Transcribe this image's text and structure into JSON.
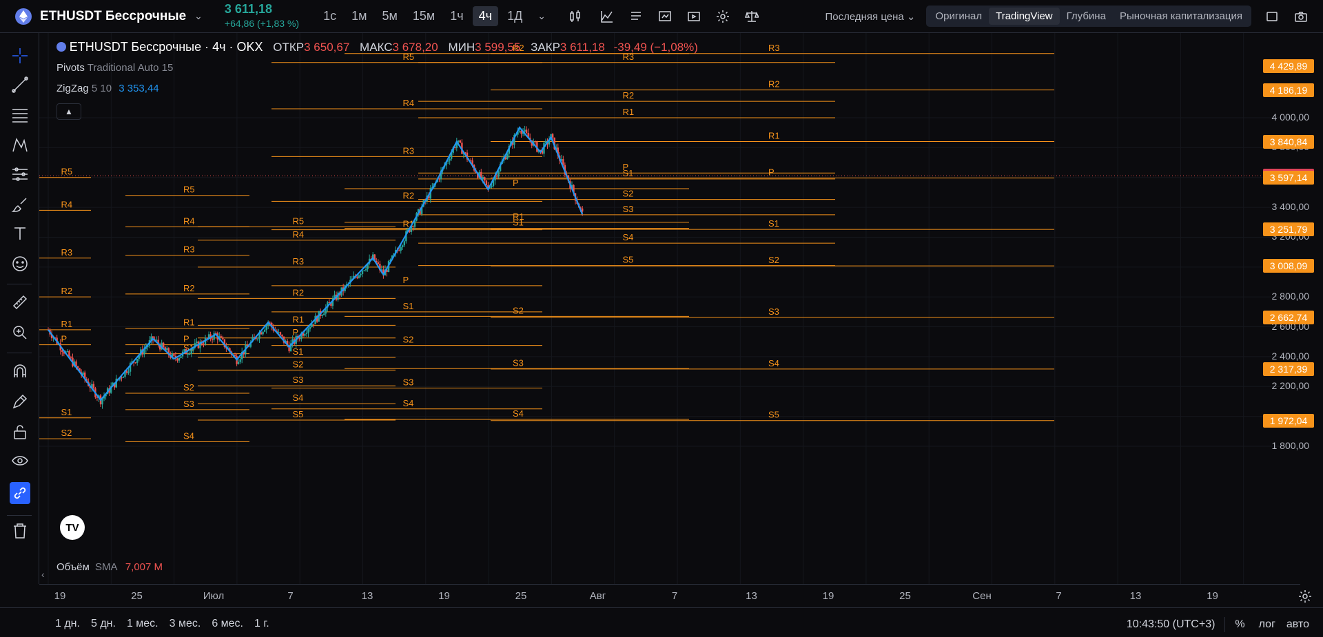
{
  "header": {
    "symbol": "ETHUSDT Бессрочные",
    "price": "3 611,18",
    "change": "+64,86 (+1,83 %)",
    "timeframes": [
      "1с",
      "1м",
      "5м",
      "15м",
      "1ч",
      "4ч",
      "1Д"
    ],
    "active_timeframe": "4ч",
    "price_type": "Последняя цена",
    "views": [
      "Оригинал",
      "TradingView",
      "Глубина",
      "Рыночная капитализация"
    ],
    "active_view": "TradingView"
  },
  "legend": {
    "title": "ETHUSDT Бессрочные · 4ч · OKX",
    "open_label": "ОТКР",
    "open": "3 650,67",
    "high_label": "МАКС",
    "high": "3 678,20",
    "low_label": "МИН",
    "low": "3 599,55",
    "close_label": "ЗАКР",
    "close": "3 611,18",
    "change": "-39,49 (−1,08%)"
  },
  "indicators": {
    "pivots_name": "Pivots",
    "pivots_params": "Traditional Auto 15",
    "zigzag_name": "ZigZag",
    "zigzag_params": "5 10",
    "zigzag_value": "3 353,44"
  },
  "volume": {
    "name": "Объём",
    "ma": "SMA",
    "value": "7,007 M"
  },
  "price_axis": {
    "labels": [
      "4 000,00",
      "3 800,00",
      "3 400,00",
      "3 200,00",
      "2 800,00",
      "2 600,00",
      "2 400,00",
      "2 200,00",
      "1 800,00"
    ],
    "boxes": [
      {
        "text": "4 429,89",
        "color": "#f7931a"
      },
      {
        "text": "4 186,19",
        "color": "#f7931a"
      },
      {
        "text": "3 840,84",
        "color": "#f7931a"
      },
      {
        "text": "3 611,18",
        "color": "#e0435a"
      },
      {
        "text": "3 597,14",
        "color": "#f7931a"
      },
      {
        "text": "3 251,79",
        "color": "#f7931a"
      },
      {
        "text": "3 008,09",
        "color": "#f7931a"
      },
      {
        "text": "2 662,74",
        "color": "#f7931a"
      },
      {
        "text": "2 317,39",
        "color": "#f7931a"
      },
      {
        "text": "1 972,04",
        "color": "#f7931a"
      }
    ]
  },
  "time_axis": [
    "19",
    "25",
    "Июл",
    "7",
    "13",
    "19",
    "25",
    "Авг",
    "7",
    "13",
    "19",
    "25",
    "Сен",
    "7",
    "13",
    "19"
  ],
  "bottom": {
    "ranges": [
      "1 дн.",
      "5 дн.",
      "1 мес.",
      "3 мес.",
      "6 мес.",
      "1 г."
    ],
    "clock": "10:43:50 (UTC+3)",
    "percent": "%",
    "log": "лог",
    "auto": "авто"
  },
  "colors": {
    "up": "#26a69a",
    "down": "#ef5350",
    "pivot": "#f7931a",
    "zigzag": "#2196f3",
    "accent": "#2962ff"
  },
  "chart_data": {
    "type": "candlestick",
    "symbol": "ETHUSDT",
    "ylim": [
      1800,
      4600
    ],
    "zigzag": [
      {
        "x": "Jun 19",
        "y": 2580
      },
      {
        "x": "Jun 24",
        "y": 2110
      },
      {
        "x": "Jun 29",
        "y": 2520
      },
      {
        "x": "Jul 1",
        "y": 2385
      },
      {
        "x": "Jul 5",
        "y": 2550
      },
      {
        "x": "Jul 7",
        "y": 2380
      },
      {
        "x": "Jul 10",
        "y": 2630
      },
      {
        "x": "Jul 12",
        "y": 2465
      },
      {
        "x": "Jul 20",
        "y": 3060
      },
      {
        "x": "Jul 21",
        "y": 2950
      },
      {
        "x": "Jul 26",
        "y": 3565
      },
      {
        "x": "Jul 28",
        "y": 3840
      },
      {
        "x": "Jul 31",
        "y": 3520
      },
      {
        "x": "Aug 3",
        "y": 3935
      },
      {
        "x": "Aug 5",
        "y": 3770
      },
      {
        "x": "Aug 6",
        "y": 3870
      },
      {
        "x": "Aug 9",
        "y": 3353
      }
    ],
    "current": 3611.18,
    "pivot_periods": [
      {
        "P": 2480,
        "R1": 2580,
        "R2": 2800,
        "R3": 3060,
        "R4": 3380,
        "R5": 3600,
        "S1": 1990,
        "S2": 1850
      },
      {
        "P": 2480,
        "R1": 2590,
        "R2": 2820,
        "R3": 3080,
        "R4": 3270,
        "R5": 3480,
        "S1": 2420,
        "S2": 2155,
        "S3": 2045,
        "S4": 1830
      },
      {
        "P": 2525,
        "R1": 2610,
        "R2": 2790,
        "R3": 3000,
        "R4": 3180,
        "R5": 3270,
        "S1": 2395,
        "S2": 2310,
        "S3": 2205,
        "S4": 2085,
        "S5": 1975
      },
      {
        "P": 2875,
        "R1": 3250,
        "R2": 3440,
        "R3": 3740,
        "R4": 4060,
        "R5": 4370,
        "S1": 2700,
        "S2": 2475,
        "S3": 2190,
        "S4": 2050
      },
      {
        "P": 3525,
        "R1": 3300,
        "R2": 4430,
        "R3": null,
        "S1": 3260,
        "S2": 2670,
        "S3": 2320,
        "S4": 1980
      },
      {
        "P": 3630,
        "R1": 4000,
        "R2": 4110,
        "R3": 4370,
        "S1": 3590,
        "S2": 3453,
        "S3": 3350,
        "S4": 3160,
        "S5": 3010
      },
      {
        "P": 3597,
        "R1": 3841,
        "R2": 4186,
        "R3": 4430,
        "S1": 3252,
        "S2": 3008,
        "S3": 2663,
        "S4": 2317,
        "S5": 1972
      }
    ]
  }
}
